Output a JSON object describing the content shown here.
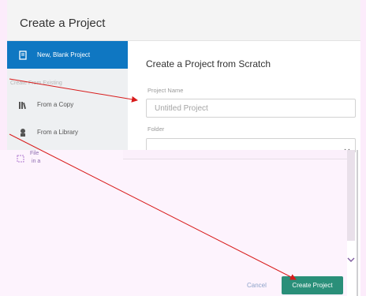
{
  "dialog": {
    "title": "Create a Project"
  },
  "sidebar": {
    "items": [
      {
        "label": "New, Blank Project",
        "icon": "blank-project-icon",
        "active": true
      },
      {
        "label": "From a Copy",
        "icon": "books-icon",
        "active": false
      },
      {
        "label": "From a Library",
        "icon": "library-icon",
        "active": false
      }
    ],
    "section_label": "Create From Existing",
    "partial_item_label": "File",
    "partial_item_sublabel": "in a"
  },
  "main": {
    "title": "Create a Project from Scratch",
    "project_name": {
      "label": "Project Name",
      "placeholder": "Untitled Project"
    },
    "folder": {
      "label": "Folder",
      "value": ""
    }
  },
  "footer": {
    "cancel_label": "Cancel",
    "create_label": "Create Project"
  },
  "colors": {
    "accent": "#0f77c2",
    "primary_button": "#2a8f79",
    "annotation_arrow": "#d81b1b"
  }
}
